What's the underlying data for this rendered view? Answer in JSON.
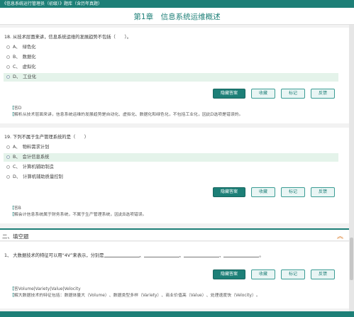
{
  "header": {
    "breadcrumb": "《信息系统运行管理员（初级）》题库（含历年真题）",
    "chapter_title": "第1章　信息系统运维概述"
  },
  "actions": {
    "show_answer": "隐藏答案",
    "favorite": "收藏",
    "mark": "标记",
    "feedback": "反馈"
  },
  "questions": [
    {
      "stem": "18. 从技术层面来讲，信息系统运维的发展趋势不包括（　　）。",
      "options": [
        {
          "letter": "A、",
          "text": "绿色化"
        },
        {
          "letter": "B、",
          "text": "数据化"
        },
        {
          "letter": "C、",
          "text": "虚拟化"
        },
        {
          "letter": "D、",
          "text": "工业化"
        }
      ],
      "selected_index": 3,
      "answer": "答D",
      "analysis": "解析从技术层面来讲，信息系统运维的发展趋势是自动化、虚拟化、数据化和绿色化，不包括工业化，因此D选项是错误的。"
    },
    {
      "stem": "19. 下列不属于生产管理系统的是（　　）",
      "options": [
        {
          "letter": "A、",
          "text": "物料需求计划"
        },
        {
          "letter": "B、",
          "text": "会计信息系统"
        },
        {
          "letter": "C、",
          "text": "计算机辅助制造"
        },
        {
          "letter": "D、",
          "text": "计算机辅助质量控制"
        }
      ],
      "selected_index": 1,
      "answer": "答B",
      "analysis": "解会计信息系统属于财务系统，不属于生产管理系统，因此B选项错误。"
    }
  ],
  "section": {
    "title": "二、填空题",
    "collapse_icon": "double-chevron-up-icon"
  },
  "fill_question": {
    "stem_prefix": "1、 大数据技术的特征可以用“4V”来表示，分别是",
    "separator": "、",
    "suffix": "。",
    "answer": "答Volume|Variety|Value|Velocity",
    "analysis": "解大数据技术的特征包括：数据体量大（Volume）、数据类型多样（Variety）、商业价值高（Value）、处理速度快（Velocity）。"
  },
  "colors": {
    "accent": "#1d7f77",
    "selected_bg": "#e4f3ea",
    "collapse": "#d8731c"
  }
}
